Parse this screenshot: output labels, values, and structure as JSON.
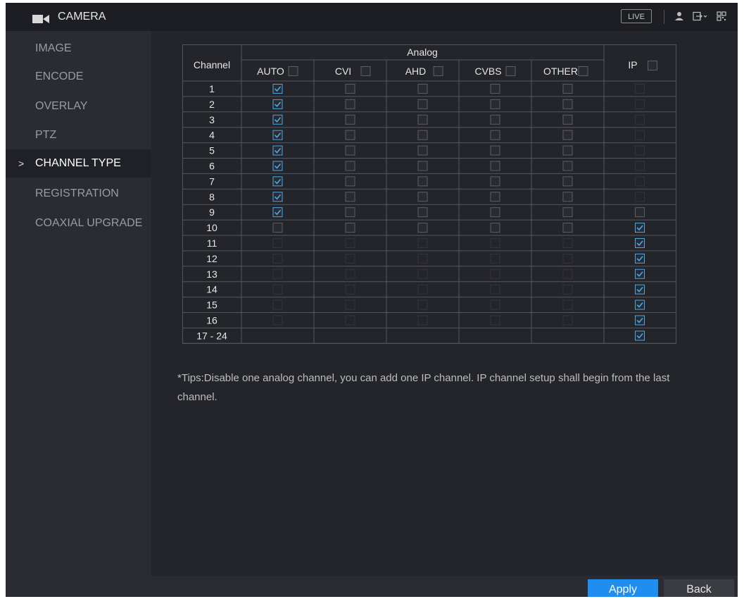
{
  "header": {
    "title": "CAMERA",
    "live_label": "LIVE",
    "icons": [
      "camera-icon",
      "user-icon",
      "logout-icon",
      "qr-code-icon"
    ]
  },
  "sidebar": {
    "items": [
      {
        "label": "IMAGE",
        "active": false
      },
      {
        "label": "ENCODE",
        "active": false
      },
      {
        "label": "OVERLAY",
        "active": false
      },
      {
        "label": "PTZ",
        "active": false
      },
      {
        "label": "CHANNEL TYPE",
        "active": true
      },
      {
        "label": "REGISTRATION",
        "active": false
      },
      {
        "label": "COAXIAL UPGRADE",
        "active": false
      }
    ],
    "active_marker": ">"
  },
  "table": {
    "channel_header": "Channel",
    "analog_header": "Analog",
    "columns": [
      "AUTO",
      "CVI",
      "AHD",
      "CVBS",
      "OTHER"
    ],
    "ip_header": "IP",
    "rows": [
      {
        "channel": "1",
        "state": "auto"
      },
      {
        "channel": "2",
        "state": "auto"
      },
      {
        "channel": "3",
        "state": "auto"
      },
      {
        "channel": "4",
        "state": "auto"
      },
      {
        "channel": "5",
        "state": "auto"
      },
      {
        "channel": "6",
        "state": "auto"
      },
      {
        "channel": "7",
        "state": "auto"
      },
      {
        "channel": "8",
        "state": "auto"
      },
      {
        "channel": "9",
        "state": "auto"
      },
      {
        "channel": "10",
        "state": "ip"
      },
      {
        "channel": "11",
        "state": "ip"
      },
      {
        "channel": "12",
        "state": "ip"
      },
      {
        "channel": "13",
        "state": "ip"
      },
      {
        "channel": "14",
        "state": "ip"
      },
      {
        "channel": "15",
        "state": "ip"
      },
      {
        "channel": "16",
        "state": "ip"
      },
      {
        "channel": "17 - 24",
        "state": "ip-only"
      }
    ]
  },
  "tips": "*Tips:Disable one analog channel, you can add one IP channel. IP channel setup shall begin from the last channel.",
  "buttons": {
    "apply": "Apply",
    "back": "Back"
  },
  "colors": {
    "accent": "#1f8ef0",
    "check": "#4aa8e8"
  }
}
